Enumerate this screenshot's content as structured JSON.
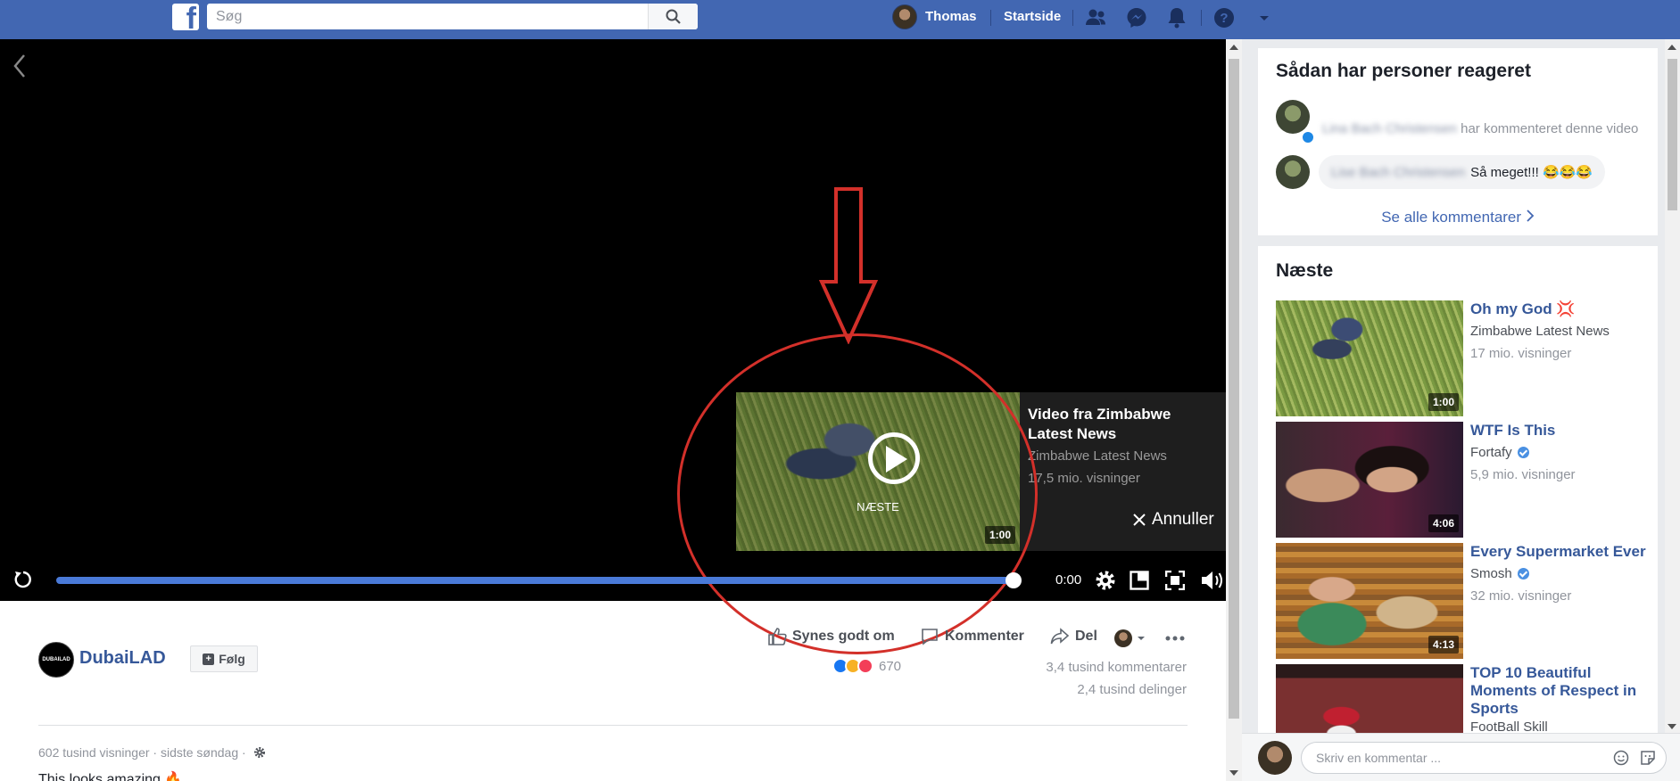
{
  "topbar": {
    "logo_letter": "f",
    "search_placeholder": "Søg",
    "user_name": "Thomas",
    "home_label": "Startside",
    "icons": [
      "friend-requests-icon",
      "messenger-icon",
      "notifications-icon",
      "help-icon",
      "account-menu-icon"
    ]
  },
  "video": {
    "time": "0:00",
    "progress": 1.0,
    "up_next": {
      "label": "NÆSTE",
      "duration": "1:00",
      "title": "Video fra Zimbabwe Latest News",
      "channel": "Zimbabwe Latest News",
      "views": "17,5 mio. visninger",
      "cancel_label": "Annuller"
    }
  },
  "post": {
    "page_name": "DubaiLAD",
    "avatar_text": "DUBAILAD",
    "follow_label": "Følg",
    "actions": {
      "like": "Synes godt om",
      "comment": "Kommenter",
      "share": "Del"
    },
    "reaction_count": "670",
    "comments_count": "3,4 tusind kommentarer",
    "shares_count": "2,4 tusind delinger",
    "meta": "602 tusind visninger · sidste søndag ·",
    "description": "This looks amazing 🔥"
  },
  "reactions_card": {
    "title": "Sådan har personer reageret",
    "line1_name": "Lina Bach Christensen",
    "line1_text": "har kommenteret denne video",
    "comment_name": "Lise Bach Christensen",
    "comment_text": "Så meget!!! 😂😂😂",
    "see_all": "Se alle kommentarer"
  },
  "next_card": {
    "title": "Næste",
    "items": [
      {
        "title": "Oh my God 💢",
        "channel": "Zimbabwe Latest News",
        "views": "17 mio. visninger",
        "duration": "1:00",
        "verified": false
      },
      {
        "title": "WTF Is This",
        "channel": "Fortafy",
        "views": "5,9 mio. visninger",
        "duration": "4:06",
        "verified": true
      },
      {
        "title": "Every Supermarket Ever",
        "channel": "Smosh",
        "views": "32 mio. visninger",
        "duration": "4:13",
        "verified": true
      },
      {
        "title": "TOP 10 Beautiful Moments of Respect in Sports",
        "channel": "FootBall Skill",
        "views": "",
        "duration": "",
        "verified": false
      }
    ]
  },
  "comment_box": {
    "placeholder": "Skriv en kommentar ..."
  },
  "colors": {
    "brand": "#4267b2",
    "link": "#365899",
    "progress": "#4a7ad8",
    "annotation": "#d3302a"
  }
}
